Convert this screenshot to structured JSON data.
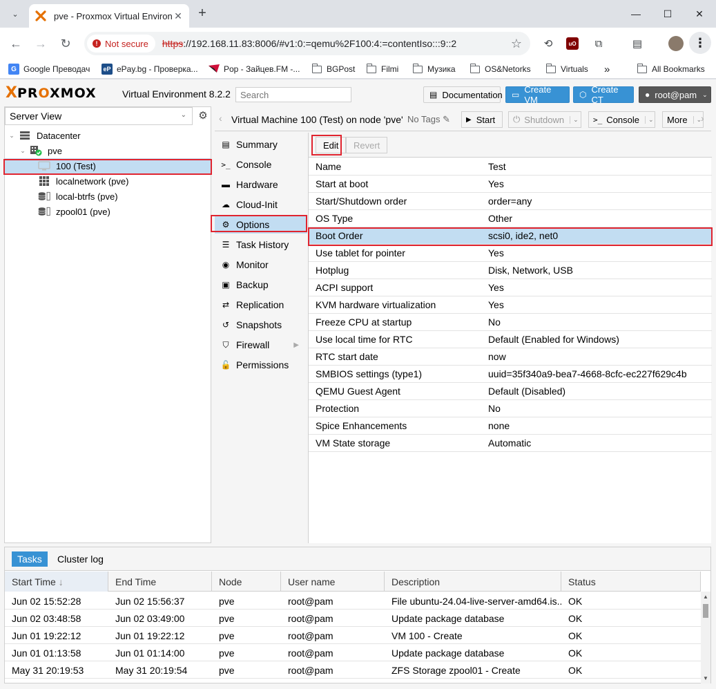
{
  "browser": {
    "tab_title": "pve - Proxmox Virtual Environme",
    "security_label": "Not secure",
    "url_scheme": "https",
    "url_rest": "://192.168.11.83:8006/#v1:0:=qemu%2F100:4:=contentIso:::9::2",
    "bookmarks": [
      {
        "label": "Google Преводач",
        "icon": "translate-icon"
      },
      {
        "label": "ePay.bg - Проверка...",
        "icon": "epay-icon"
      },
      {
        "label": "Pop - Зайцев.FM -...",
        "icon": "radio-icon"
      },
      {
        "label": "BGPost",
        "icon": "folder-icon"
      },
      {
        "label": "Filmi",
        "icon": "folder-icon"
      },
      {
        "label": "Музика",
        "icon": "folder-icon"
      },
      {
        "label": "OS&Netorks",
        "icon": "folder-icon"
      },
      {
        "label": "Virtuals",
        "icon": "folder-icon"
      }
    ],
    "more_bookmarks": "»",
    "all_bookmarks": "All Bookmarks"
  },
  "header": {
    "logo_x": "X",
    "logo_word_1": "PR",
    "logo_o": "O",
    "logo_word_2": "XMOX",
    "version": "Virtual Environment 8.2.2",
    "search_placeholder": "Search",
    "documentation": "Documentation",
    "create_vm": "Create VM",
    "create_ct": "Create CT",
    "user": "root@pam",
    "accent_color": "#3892d4",
    "brand_color": "#e57000"
  },
  "tree": {
    "view": "Server View",
    "nodes": [
      {
        "label": "Datacenter",
        "icon": "datacenter-icon"
      },
      {
        "label": "pve",
        "icon": "node-online-icon"
      },
      {
        "label": "100 (Test)",
        "icon": "vm-icon"
      },
      {
        "label": "localnetwork (pve)",
        "icon": "network-icon"
      },
      {
        "label": "local-btrfs (pve)",
        "icon": "storage-icon"
      },
      {
        "label": "zpool01 (pve)",
        "icon": "storage-icon"
      }
    ]
  },
  "content": {
    "title": "Virtual Machine 100 (Test) on node 'pve'",
    "tags": "No Tags",
    "start": "Start",
    "shutdown": "Shutdown",
    "console": "Console",
    "more": "More"
  },
  "menu": [
    {
      "label": "Summary",
      "icon": "summary-icon"
    },
    {
      "label": "Console",
      "icon": "console-icon"
    },
    {
      "label": "Hardware",
      "icon": "hardware-icon"
    },
    {
      "label": "Cloud-Init",
      "icon": "cloud-icon"
    },
    {
      "label": "Options",
      "icon": "gear-icon"
    },
    {
      "label": "Task History",
      "icon": "list-icon"
    },
    {
      "label": "Monitor",
      "icon": "eye-icon"
    },
    {
      "label": "Backup",
      "icon": "floppy-icon"
    },
    {
      "label": "Replication",
      "icon": "retweet-icon"
    },
    {
      "label": "Snapshots",
      "icon": "history-icon"
    },
    {
      "label": "Firewall",
      "icon": "shield-icon"
    },
    {
      "label": "Permissions",
      "icon": "unlock-icon"
    }
  ],
  "options_toolbar": {
    "edit": "Edit",
    "revert": "Revert"
  },
  "options": [
    {
      "key": "Name",
      "value": "Test"
    },
    {
      "key": "Start at boot",
      "value": "Yes"
    },
    {
      "key": "Start/Shutdown order",
      "value": "order=any"
    },
    {
      "key": "OS Type",
      "value": "Other"
    },
    {
      "key": "Boot Order",
      "value": "scsi0, ide2, net0"
    },
    {
      "key": "Use tablet for pointer",
      "value": "Yes"
    },
    {
      "key": "Hotplug",
      "value": "Disk, Network, USB"
    },
    {
      "key": "ACPI support",
      "value": "Yes"
    },
    {
      "key": "KVM hardware virtualization",
      "value": "Yes"
    },
    {
      "key": "Freeze CPU at startup",
      "value": "No"
    },
    {
      "key": "Use local time for RTC",
      "value": "Default (Enabled for Windows)"
    },
    {
      "key": "RTC start date",
      "value": "now"
    },
    {
      "key": "SMBIOS settings (type1)",
      "value": "uuid=35f340a9-bea7-4668-8cfc-ec227f629c4b"
    },
    {
      "key": "QEMU Guest Agent",
      "value": "Default (Disabled)"
    },
    {
      "key": "Protection",
      "value": "No"
    },
    {
      "key": "Spice Enhancements",
      "value": "none"
    },
    {
      "key": "VM State storage",
      "value": "Automatic"
    }
  ],
  "tasks": {
    "tab_tasks": "Tasks",
    "tab_cluster_log": "Cluster log",
    "columns": [
      "Start Time",
      "End Time",
      "Node",
      "User name",
      "Description",
      "Status"
    ],
    "sort_indicator": "↓",
    "rows": [
      [
        "Jun 02 15:52:28",
        "Jun 02 15:56:37",
        "pve",
        "root@pam",
        "File ubuntu-24.04-live-server-amd64.is...",
        "OK"
      ],
      [
        "Jun 02 03:48:58",
        "Jun 02 03:49:00",
        "pve",
        "root@pam",
        "Update package database",
        "OK"
      ],
      [
        "Jun 01 19:22:12",
        "Jun 01 19:22:12",
        "pve",
        "root@pam",
        "VM 100 - Create",
        "OK"
      ],
      [
        "Jun 01 01:13:58",
        "Jun 01 01:14:00",
        "pve",
        "root@pam",
        "Update package database",
        "OK"
      ],
      [
        "May 31 20:19:53",
        "May 31 20:19:54",
        "pve",
        "root@pam",
        "ZFS Storage zpool01 - Create",
        "OK"
      ]
    ]
  }
}
